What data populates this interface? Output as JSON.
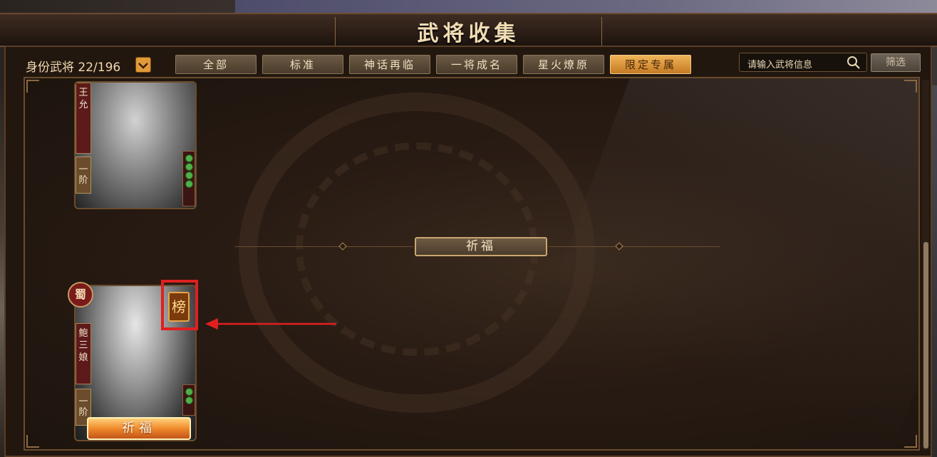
{
  "window": {
    "title": "武将收集"
  },
  "toolbar": {
    "count_label": "身份武将 22/196",
    "count_toggle_icon": "chevron-down-icon",
    "tabs": [
      {
        "label": "全部",
        "active": false
      },
      {
        "label": "标准",
        "active": false
      },
      {
        "label": "神话再临",
        "active": false
      },
      {
        "label": "一将成名",
        "active": false
      },
      {
        "label": "星火燎原",
        "active": false
      },
      {
        "label": "限定专属",
        "active": true
      }
    ],
    "search": {
      "value": "请输入武将信息",
      "icon": "search-icon"
    },
    "filter_label": "筛选"
  },
  "cards": [
    {
      "name_chars": [
        "王",
        "允"
      ],
      "tier_chars": [
        "一",
        "阶"
      ]
    },
    {
      "faction": "蜀",
      "name_chars": [
        "鲍",
        "三",
        "娘"
      ],
      "tier_chars": [
        "一",
        "阶"
      ],
      "rank_badge": "榜",
      "action_label": "祈福"
    }
  ],
  "section": {
    "title": "祈福"
  },
  "colors": {
    "accent": "#e09a3a",
    "active_tab": "#f0b458",
    "highlight": "#e02020",
    "hp_green": "#4fb04a"
  }
}
